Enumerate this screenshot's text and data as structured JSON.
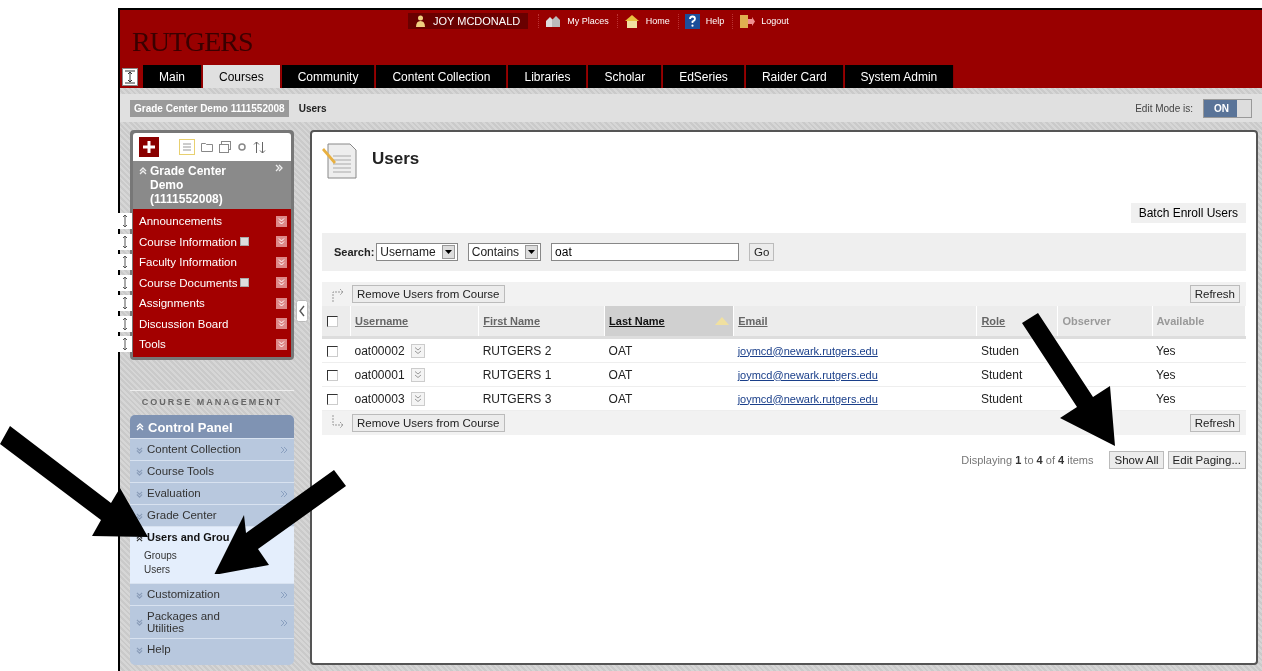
{
  "header": {
    "logo": "RUTGERS",
    "user": "JOY MCDONALD",
    "links": [
      {
        "kind": "places",
        "label": "My Places"
      },
      {
        "kind": "home",
        "label": "Home"
      },
      {
        "kind": "help",
        "label": "Help"
      },
      {
        "kind": "logout",
        "label": "Logout"
      }
    ]
  },
  "tabs": [
    {
      "label": "Main",
      "selected": false
    },
    {
      "label": "Courses",
      "selected": true
    },
    {
      "label": "Community",
      "selected": false
    },
    {
      "label": "Content Collection",
      "selected": false
    },
    {
      "label": "Libraries",
      "selected": false
    },
    {
      "label": "Scholar",
      "selected": false
    },
    {
      "label": "EdSeries",
      "selected": false
    },
    {
      "label": "Raider Card",
      "selected": false
    },
    {
      "label": "System Admin",
      "selected": false
    }
  ],
  "breadcrumb": {
    "course": "Grade Center Demo 1111552008",
    "page": "Users",
    "edit_mode_label": "Edit Mode is:",
    "edit_mode_value": "ON",
    "edit_mode_on": true
  },
  "course_menu": {
    "title": "Grade Center Demo (1111552008)",
    "items": [
      {
        "label": "Announcements",
        "has_page_icon": false
      },
      {
        "label": "Course Information",
        "has_page_icon": true
      },
      {
        "label": "Faculty Information",
        "has_page_icon": false
      },
      {
        "label": "Course Documents",
        "has_page_icon": true
      },
      {
        "label": "Assignments",
        "has_page_icon": false
      },
      {
        "label": "Discussion Board",
        "has_page_icon": false
      },
      {
        "label": "Tools",
        "has_page_icon": false
      }
    ]
  },
  "course_management": {
    "heading": "COURSE MANAGEMENT",
    "title": "Control Panel",
    "items": [
      {
        "label": "Content Collection",
        "expanded": false,
        "has_submenu": true
      },
      {
        "label": "Course Tools",
        "expanded": false,
        "has_submenu": false
      },
      {
        "label": "Evaluation",
        "expanded": false,
        "has_submenu": true
      },
      {
        "label": "Grade Center",
        "expanded": false
      },
      {
        "label": "Users and Grou",
        "expanded": true,
        "children": [
          {
            "label": "Groups"
          },
          {
            "label": "Users"
          }
        ]
      },
      {
        "label": "Customization",
        "expanded": false,
        "has_submenu": true
      },
      {
        "label": "Packages and Utilities",
        "expanded": false,
        "has_submenu": true
      },
      {
        "label": "Help",
        "expanded": false,
        "has_submenu": false
      }
    ]
  },
  "main": {
    "title": "Users",
    "batch_button": "Batch Enroll Users",
    "search": {
      "label": "Search:",
      "field": "Username",
      "operator": "Contains",
      "value": "oat",
      "go": "Go"
    },
    "top_actions": {
      "remove_button": "Remove Users from Course",
      "refresh_button": "Refresh"
    },
    "bottom_actions": {
      "remove_button": "Remove Users from Course",
      "refresh_button": "Refresh"
    },
    "table": {
      "select_all_checked": false,
      "columns": [
        {
          "label": "Username",
          "sortable": true,
          "sorted": false
        },
        {
          "label": "First Name",
          "sortable": true,
          "sorted": false
        },
        {
          "label": "Last Name",
          "sortable": true,
          "sorted": true
        },
        {
          "label": "Email",
          "sortable": true,
          "sorted": false
        },
        {
          "label": "Role",
          "sortable": true,
          "sorted": false
        },
        {
          "label": "Observer",
          "sortable": false,
          "sorted": false
        },
        {
          "label": "Available",
          "sortable": false,
          "sorted": false
        }
      ],
      "rows": [
        {
          "checked": false,
          "username": "oat00002",
          "first_name": "RUTGERS 2",
          "last_name": "OAT",
          "email": "joymcd@newark.rutgers.edu",
          "role": "Studen",
          "available": "Yes"
        },
        {
          "checked": false,
          "username": "oat00001",
          "first_name": "RUTGERS 1",
          "last_name": "OAT",
          "email": "joymcd@newark.rutgers.edu",
          "role": "Student",
          "available": "Yes"
        },
        {
          "checked": false,
          "username": "oat00003",
          "first_name": "RUTGERS 3",
          "last_name": "OAT",
          "email": "joymcd@newark.rutgers.edu",
          "role": "Student",
          "available": "Yes"
        }
      ]
    },
    "paging": {
      "summary": "Displaying **1** to **4** of **4** items",
      "show_all": "Show All",
      "edit_paging": "Edit Paging..."
    }
  }
}
